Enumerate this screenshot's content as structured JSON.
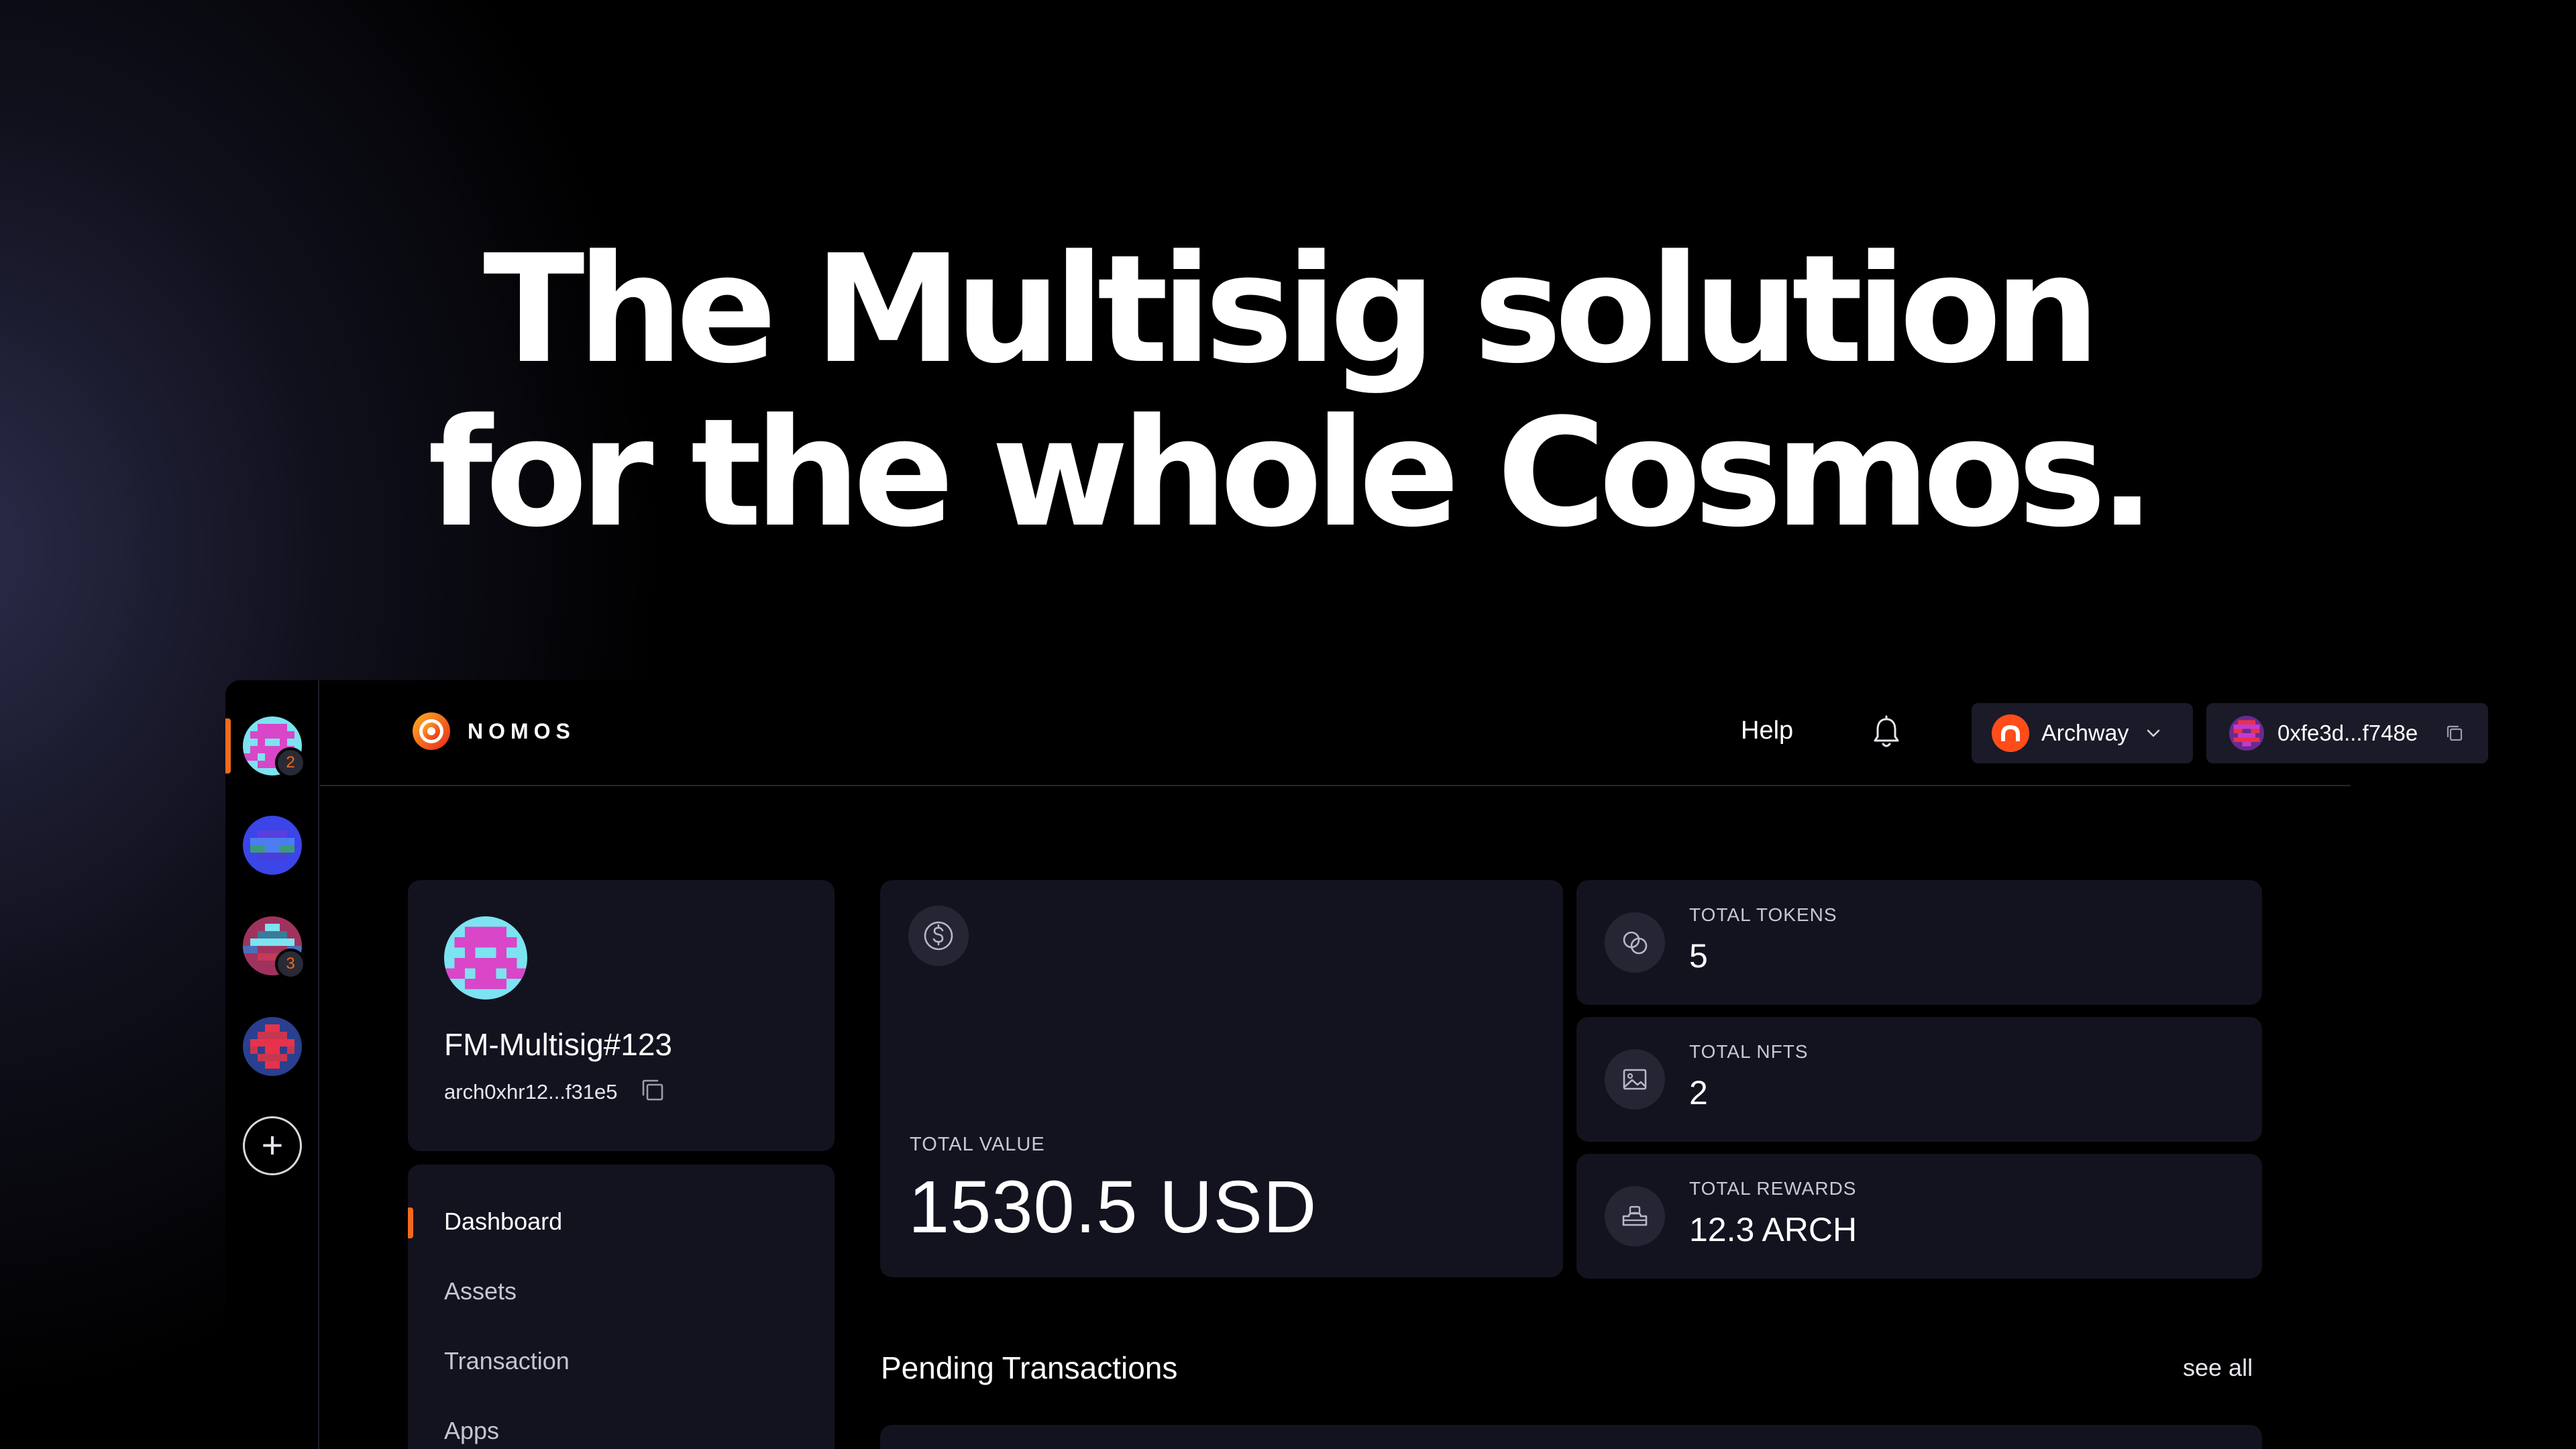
{
  "hero": {
    "line1": "The Multisig solution",
    "line2": "for the whole Cosmos."
  },
  "rail": {
    "accounts": [
      {
        "name": "account-1",
        "badge": "2"
      },
      {
        "name": "account-2",
        "badge": ""
      },
      {
        "name": "account-3",
        "badge": "3"
      },
      {
        "name": "account-4",
        "badge": ""
      }
    ],
    "add_label": "+"
  },
  "header": {
    "logo_text": "NOMOS",
    "help_label": "Help",
    "chain_label": "Archway",
    "wallet_label": "0xfe3d...f748e",
    "icons": [
      "bell-icon",
      "chevron-down-icon",
      "copy-icon"
    ]
  },
  "profile": {
    "name": "FM-Multisig#123",
    "address": "arch0xhr12...f31e5"
  },
  "nav": {
    "items": [
      "Dashboard",
      "Assets",
      "Transaction",
      "Apps"
    ],
    "active": "Dashboard"
  },
  "total_value": {
    "label": "TOTAL VALUE",
    "amount": "1530.5 USD"
  },
  "stats": [
    {
      "label": "TOTAL TOKENS",
      "value": "5",
      "icon": "tokens-icon"
    },
    {
      "label": "TOTAL NFTS",
      "value": "2",
      "icon": "image-icon"
    },
    {
      "label": "TOTAL REWARDS",
      "value": "12.3 ARCH",
      "icon": "rewards-icon"
    }
  ],
  "pending": {
    "title": "Pending Transactions",
    "see_all": "see all"
  },
  "colors": {
    "accent": "#f26a1b",
    "card_bg": "#131320",
    "button_bg": "#1a1a28",
    "archway": "#ff4d1a"
  }
}
